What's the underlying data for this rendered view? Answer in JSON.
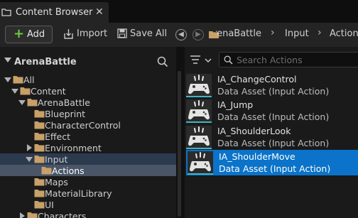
{
  "tab": {
    "title": "Content Browser",
    "close": "✕"
  },
  "toolbar": {
    "add_label": "Add",
    "import_label": "Import",
    "save_all_label": "Save All",
    "breadcrumb": [
      "ArenaBattle",
      "Input",
      "Actions"
    ]
  },
  "sidebar": {
    "title": "ArenaBattle",
    "tree": [
      {
        "label": "All",
        "depth": 0,
        "expander": "open"
      },
      {
        "label": "Content",
        "depth": 1,
        "expander": "open"
      },
      {
        "label": "ArenaBattle",
        "depth": 2,
        "expander": "open"
      },
      {
        "label": "Blueprint",
        "depth": 3,
        "expander": "none"
      },
      {
        "label": "CharacterControl",
        "depth": 3,
        "expander": "none"
      },
      {
        "label": "Effect",
        "depth": 3,
        "expander": "none"
      },
      {
        "label": "Environment",
        "depth": 3,
        "expander": "closed"
      },
      {
        "label": "Input",
        "depth": 3,
        "expander": "open"
      },
      {
        "label": "Actions",
        "depth": 4,
        "expander": "none"
      },
      {
        "label": "Maps",
        "depth": 3,
        "expander": "none"
      },
      {
        "label": "MaterialLibrary",
        "depth": 3,
        "expander": "none"
      },
      {
        "label": "UI",
        "depth": 3,
        "expander": "none"
      },
      {
        "label": "Characters",
        "depth": 2,
        "expander": "closed"
      }
    ]
  },
  "search": {
    "placeholder": "Search Actions"
  },
  "assets": [
    {
      "name": "IA_ChangeControl",
      "type": "Data Asset (Input Action)",
      "selected": false
    },
    {
      "name": "IA_Jump",
      "type": "Data Asset (Input Action)",
      "selected": false
    },
    {
      "name": "IA_ShoulderLook",
      "type": "Data Asset (Input Action)",
      "selected": false
    },
    {
      "name": "IA_ShoulderMove",
      "type": "Data Asset (Input Action)",
      "selected": true
    }
  ],
  "colors": {
    "accent": "#0b73c9",
    "folder": "#c8a068",
    "add_plus": "#6dcc3c",
    "asset_underline": "#3fb5c8"
  },
  "icons": [
    "content-browser-icon",
    "close-icon",
    "plus-icon",
    "import-icon",
    "save-icon",
    "back-icon",
    "forward-icon",
    "chevron-right-icon",
    "search-icon",
    "filter-icon",
    "folder-icon",
    "gamepad-icon"
  ]
}
